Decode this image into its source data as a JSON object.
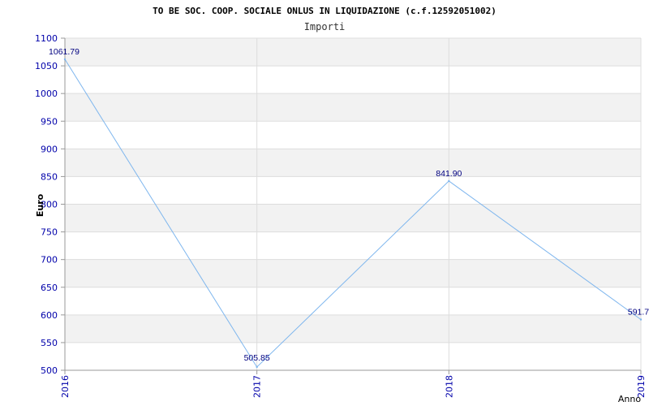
{
  "chart_data": {
    "type": "line",
    "title": "TO BE SOC. COOP. SOCIALE ONLUS IN LIQUIDAZIONE (c.f.12592051002)",
    "subtitle": "Importi",
    "xlabel": "Anno",
    "ylabel": "Euro",
    "categories": [
      "2016",
      "2017",
      "2018",
      "2019"
    ],
    "series": [
      {
        "values": [
          1061.79,
          505.85,
          841.9,
          591.7
        ]
      }
    ],
    "data_labels": [
      "1061.79",
      "505.85",
      "841.90",
      "591.7"
    ],
    "ylim": [
      500,
      1100
    ],
    "yticks": [
      500,
      550,
      600,
      650,
      700,
      750,
      800,
      850,
      900,
      950,
      1000,
      1050,
      1100
    ],
    "grid": true,
    "colors": {
      "line": "#7eb6ee",
      "band": "#f2f2f2",
      "grid": "#dddddd",
      "tick": "#0000aa",
      "label": "#000080"
    }
  }
}
